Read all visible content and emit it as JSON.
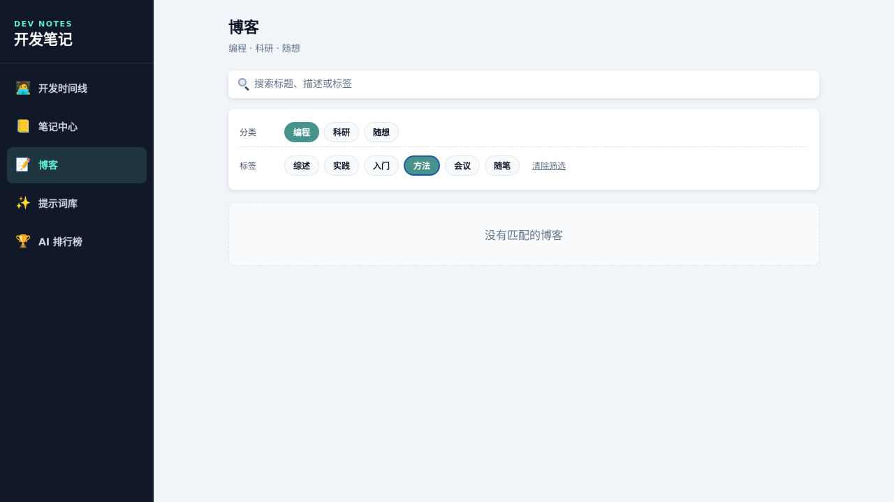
{
  "sidebar": {
    "brand_sub": "DEV NOTES",
    "brand_title": "开发笔记",
    "items": [
      {
        "icon": "🧑‍💻",
        "icon_name": "developer-icon",
        "label": "开发时间线"
      },
      {
        "icon": "📒",
        "icon_name": "notebook-icon",
        "label": "笔记中心"
      },
      {
        "icon": "📝",
        "icon_name": "memo-icon",
        "label": "博客"
      },
      {
        "icon": "✨",
        "icon_name": "sparkles-icon",
        "label": "提示词库"
      },
      {
        "icon": "🏆",
        "icon_name": "trophy-icon",
        "label": "AI 排行榜"
      }
    ],
    "active_index": 2
  },
  "main": {
    "title": "博客",
    "subtitle": "编程 · 科研 · 随想",
    "search": {
      "placeholder": "搜索标题、描述或标签",
      "value": ""
    },
    "filters": {
      "category_label": "分类",
      "categories": [
        "编程",
        "科研",
        "随想"
      ],
      "selected_category": "编程",
      "tag_label": "标签",
      "tags": [
        "综述",
        "实践",
        "入门",
        "方法",
        "会议",
        "随笔"
      ],
      "selected_tag": "方法",
      "clear_label": "清除筛选"
    },
    "empty_message": "没有匹配的博客"
  },
  "colors": {
    "sidebar_bg": "#111827",
    "accent": "#5eead4",
    "chip_selected": "#47928a",
    "focus_ring": "#1e5aa8"
  }
}
